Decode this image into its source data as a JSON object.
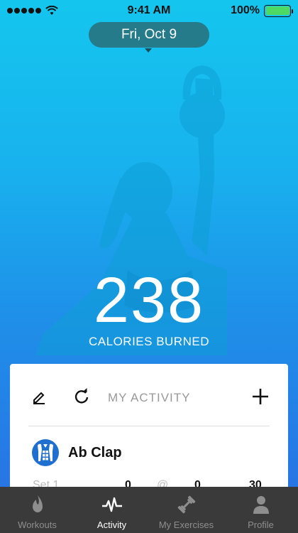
{
  "status_bar": {
    "time": "9:41 AM",
    "battery": "100%"
  },
  "date_selector": {
    "label": "Fri, Oct 9"
  },
  "summary": {
    "calories": "238",
    "calories_label": "CALORIES BURNED"
  },
  "activity_card": {
    "title": "MY ACTIVITY",
    "edit_icon": "pencil-icon",
    "refresh_icon": "refresh-icon",
    "add_icon": "plus-icon",
    "exercise": {
      "name": "Ab Clap",
      "icon": "abs-torso-icon"
    },
    "set_row": {
      "label": "Set 1",
      "reps": "0",
      "at": "@",
      "weight": "0",
      "time": "30"
    }
  },
  "tab_bar": {
    "items": [
      {
        "label": "Workouts",
        "icon": "flame-icon",
        "active": false
      },
      {
        "label": "Activity",
        "icon": "pulse-icon",
        "active": true
      },
      {
        "label": "My Exercises",
        "icon": "dumbbell-icon",
        "active": false
      },
      {
        "label": "Profile",
        "icon": "person-icon",
        "active": false
      }
    ]
  },
  "colors": {
    "gradient_top": "#14c6ee",
    "gradient_bottom": "#2a6ee3",
    "date_pill": "#286e78",
    "tab_bar": "#3a3a3a",
    "exercise_icon": "#1f6fd0"
  }
}
